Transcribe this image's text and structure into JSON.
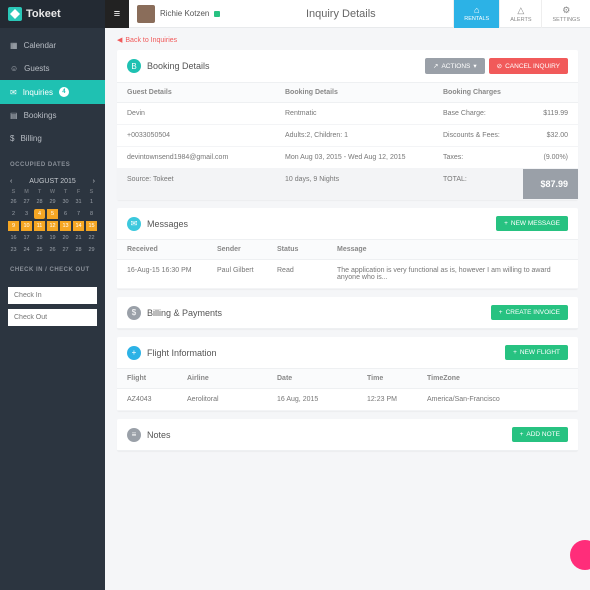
{
  "brand": "Tokeet",
  "user": {
    "name": "Richie Kotzen"
  },
  "page_title": "Inquiry Details",
  "header_tabs": [
    {
      "label": "RENTALS",
      "active": true
    },
    {
      "label": "ALERTS",
      "active": false
    },
    {
      "label": "SETTINGS",
      "active": false
    }
  ],
  "sidebar": {
    "items": [
      {
        "icon": "calendar-icon",
        "label": "Calendar",
        "active": false
      },
      {
        "icon": "guests-icon",
        "label": "Guests",
        "active": false
      },
      {
        "icon": "inquiries-icon",
        "label": "Inquiries",
        "active": true,
        "badge": "4"
      },
      {
        "icon": "bookings-icon",
        "label": "Bookings",
        "active": false
      },
      {
        "icon": "billing-icon",
        "label": "Billing",
        "active": false
      }
    ],
    "occupied_heading": "OCCUPIED DATES",
    "calendar": {
      "month": "AUGUST 2015",
      "dow": [
        "S",
        "M",
        "T",
        "W",
        "T",
        "F",
        "S"
      ]
    },
    "check_heading": "CHECK IN / CHECK OUT",
    "check_in_ph": "Check In",
    "check_out_ph": "Check Out"
  },
  "back_link": "Back to Inquiries",
  "booking": {
    "title": "Booking Details",
    "actions_btn": "ACTIONS",
    "cancel_btn": "CANCEL INQUIRY",
    "headers": {
      "guest": "Guest Details",
      "book": "Booking Details",
      "charge": "Booking Charges"
    },
    "rows": [
      {
        "c1": "Devin",
        "c2": "Rentmatic",
        "c3": "Base Charge:",
        "c4": "$119.99"
      },
      {
        "c1": "+0033050504",
        "c2": "Adults:2, Children: 1",
        "c3": "Discounts & Fees:",
        "c4": "$32.00"
      },
      {
        "c1": "devintownsend1984@gmail.com",
        "c2": "Mon Aug 03, 2015 - Wed Aug 12, 2015",
        "c3": "Taxes:",
        "c4": "(9.00%)"
      },
      {
        "c1": "Source: Tokeet",
        "c2": "10 days, 9 Nights",
        "c3": "TOTAL:",
        "c4": "$87.99"
      }
    ]
  },
  "messages": {
    "title": "Messages",
    "new_btn": "NEW MESSAGE",
    "headers": {
      "recv": "Received",
      "send": "Sender",
      "stat": "Status",
      "msg": "Message"
    },
    "row": {
      "recv": "16-Aug-15 16:30 PM",
      "send": "Paul Gilbert",
      "stat": "Read",
      "msg": "The application is very functional as is, however I am willing to award anyone who is..."
    }
  },
  "billing": {
    "title": "Billing & Payments",
    "btn": "CREATE INVOICE"
  },
  "flight": {
    "title": "Flight Information",
    "btn": "NEW FLIGHT",
    "headers": {
      "f": "Flight",
      "a": "Airline",
      "d": "Date",
      "t": "Time",
      "tz": "TimeZone"
    },
    "row": {
      "f": "AZ4043",
      "a": "Aerolitoral",
      "d": "16 Aug, 2015",
      "t": "12:23 PM",
      "tz": "America/San-Francisco"
    }
  },
  "notes": {
    "title": "Notes",
    "btn": "ADD NOTE"
  }
}
